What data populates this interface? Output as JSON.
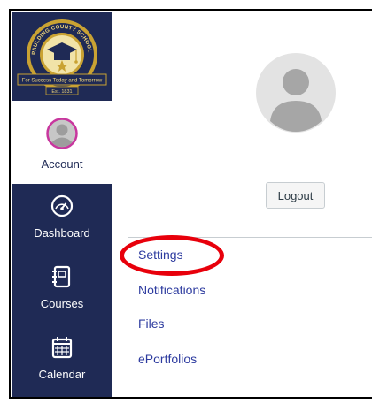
{
  "logo": {
    "ring_text_top": "PAULDING COUNTY SCHOOL DISTRICT",
    "banner_text": "For Success Today and Tomorrow",
    "established": "Est. 1831"
  },
  "nav": {
    "account_label": "Account",
    "items": [
      {
        "label": "Dashboard",
        "icon": "speedometer-icon"
      },
      {
        "label": "Courses",
        "icon": "notebook-icon"
      },
      {
        "label": "Calendar",
        "icon": "calendar-icon"
      }
    ]
  },
  "tray": {
    "logout_label": "Logout",
    "links": [
      {
        "label": "Settings"
      },
      {
        "label": "Notifications"
      },
      {
        "label": "Files"
      },
      {
        "label": "ePortfolios"
      }
    ]
  },
  "colors": {
    "nav_bg": "#1f2a55",
    "link": "#2d3b9f",
    "highlight": "#e8000b",
    "avatar_ring": "#c8379e"
  }
}
